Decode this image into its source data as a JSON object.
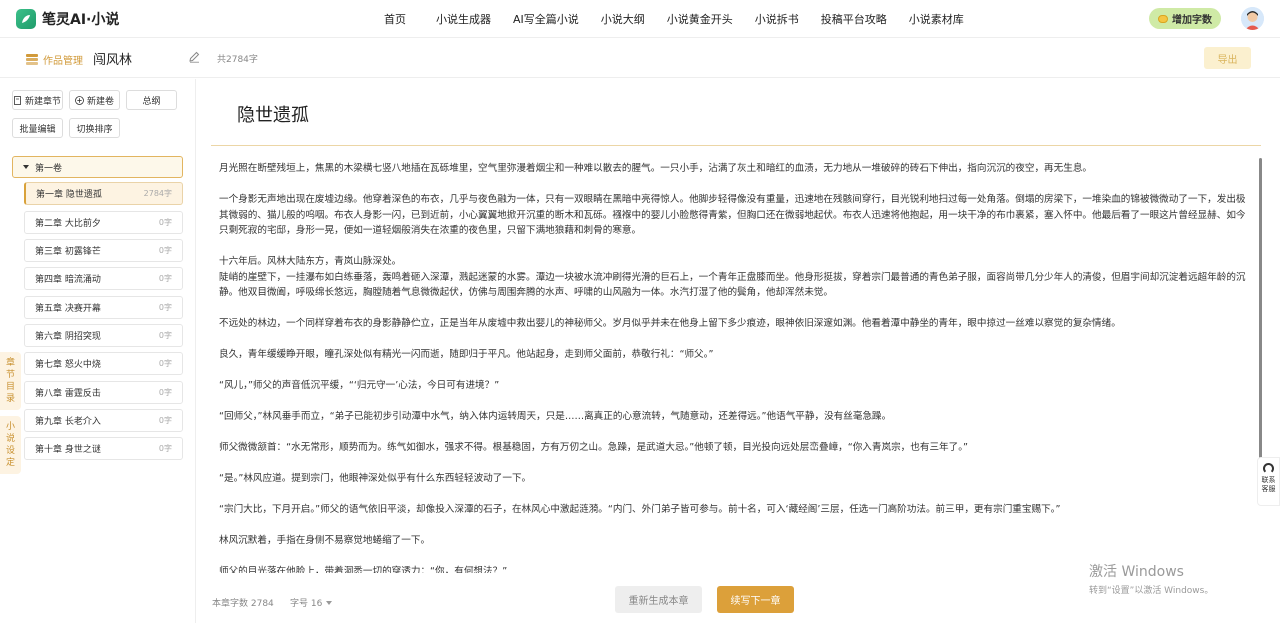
{
  "app": {
    "name": "笔灵AI·小说"
  },
  "nav": {
    "items": [
      "首页",
      "小说生成器",
      "AI写全篇小说",
      "小说大纲",
      "小说黄金开头",
      "小说拆书",
      "投稿平台攻略",
      "小说素材库"
    ],
    "add_words": "增加字数"
  },
  "subheader": {
    "works_label": "作品管理",
    "book_title": "闯风林",
    "total_words": "共2784字",
    "export": "导出"
  },
  "sidebar": {
    "new_chapter": "新建章节",
    "new_volume": "新建卷",
    "outline": "总纲",
    "batch_edit": "批量编辑",
    "switch_sort": "切换排序",
    "volume": "第一卷",
    "chapters": [
      {
        "title": "第一章 隐世遗孤",
        "count": "2784字",
        "active": true
      },
      {
        "title": "第二章 大比前夕",
        "count": "0字"
      },
      {
        "title": "第三章 初露锋芒",
        "count": "0字"
      },
      {
        "title": "第四章 暗流涌动",
        "count": "0字"
      },
      {
        "title": "第五章 决赛开幕",
        "count": "0字"
      },
      {
        "title": "第六章 阴招突现",
        "count": "0字"
      },
      {
        "title": "第七章 怒火中烧",
        "count": "0字"
      },
      {
        "title": "第八章 雷霆反击",
        "count": "0字"
      },
      {
        "title": "第九章 长老介入",
        "count": "0字"
      },
      {
        "title": "第十章 身世之谜",
        "count": "0字"
      }
    ],
    "tab_catalog": [
      "章",
      "节",
      "目",
      "录"
    ],
    "tab_settings": [
      "小",
      "说",
      "设",
      "定"
    ]
  },
  "editor": {
    "title": "隐世遗孤",
    "paragraphs": [
      "月光照在断壁残垣上，焦黑的木梁横七竖八地插在瓦砾堆里，空气里弥漫着烟尘和一种难以散去的腥气。一只小手，沾满了灰土和暗红的血渍，无力地从一堆破碎的砖石下伸出，指向沉沉的夜空，再无生息。",
      "一个身影无声地出现在废墟边缘。他穿着深色的布衣，几乎与夜色融为一体，只有一双眼睛在黑暗中亮得惊人。他脚步轻得像没有重量，迅速地在残骸间穿行，目光锐利地扫过每一处角落。倒塌的房梁下，一堆染血的锦被微微动了一下，发出极其微弱的、猫儿般的呜咽。布衣人身影一闪，已到近前，小心翼翼地掀开沉重的断木和瓦砾。襁褓中的婴儿小脸憋得青紫，但胸口还在微弱地起伏。布衣人迅速将他抱起，用一块干净的布巾裹紧，塞入怀中。他最后看了一眼这片曾经显赫、如今只剩死寂的宅邸，身形一晃，便如一道轻烟般消失在浓重的夜色里，只留下满地狼藉和刺骨的寒意。",
      "十六年后。风林大陆东方，青岚山脉深处。\n陡峭的崖壁下，一挂瀑布如白练垂落，轰鸣着砸入深潭，溅起迷蒙的水雾。潭边一块被水流冲刷得光滑的巨石上，一个青年正盘膝而坐。他身形挺拔，穿着宗门最普通的青色弟子服，面容尚带几分少年人的清俊，但眉宇间却沉淀着远超年龄的沉静。他双目微阖，呼吸绵长悠远，胸膛随着气息微微起伏，仿佛与周围奔腾的水声、呼啸的山风融为一体。水汽打湿了他的鬓角，他却浑然未觉。",
      "不远处的林边，一个同样穿着布衣的身影静静伫立，正是当年从废墟中救出婴儿的神秘师父。岁月似乎并未在他身上留下多少痕迹，眼神依旧深邃如渊。他看着潭中静坐的青年，眼中掠过一丝难以察觉的复杂情绪。",
      "良久，青年缓缓睁开眼，瞳孔深处似有精光一闪而逝，随即归于平凡。他站起身，走到师父面前，恭敬行礼：“师父。”",
      "“风儿，”师父的声音低沉平缓，“‘归元守一’心法，今日可有进境？”",
      "“回师父，”林风垂手而立，“弟子已能初步引动潭中水气，纳入体内运转周天，只是……离真正的心意流转，气随意动，还差得远。”他语气平静，没有丝毫急躁。",
      "师父微微颔首：“水无常形，顺势而为。练气如御水，强求不得。根基稳固，方有万仞之山。急躁，是武道大忌。”他顿了顿，目光投向远处层峦叠嶂，“你入青岚宗，也有三年了。”",
      "“是。”林风应道。提到宗门，他眼神深处似乎有什么东西轻轻波动了一下。",
      "“宗门大比，下月开启。”师父的语气依旧平淡，却像投入深潭的石子，在林风心中激起涟漪。“内门、外门弟子皆可参与。前十名，可入‘藏经阁’三层，任选一门高阶功法。前三甲，更有宗门重宝赐下。”",
      "林风沉默着，手指在身侧不易察觉地蜷缩了一下。",
      "师父的目光落在他脸上，带着洞悉一切的穿透力：“你，有何想法？”"
    ]
  },
  "bottom": {
    "chapter_words": "本章字数 2784",
    "font_size": "字号 16",
    "regenerate": "重新生成本章",
    "continue": "续写下一章"
  },
  "float": {
    "service": [
      "联系",
      "客服"
    ]
  },
  "watermark": {
    "line1": "激活 Windows",
    "line2": "转到“设置”以激活 Windows。"
  },
  "colors": {
    "accent": "#dca03a",
    "add_words_bg": "#cfeaa6",
    "brand_green": "#2bb07a"
  }
}
